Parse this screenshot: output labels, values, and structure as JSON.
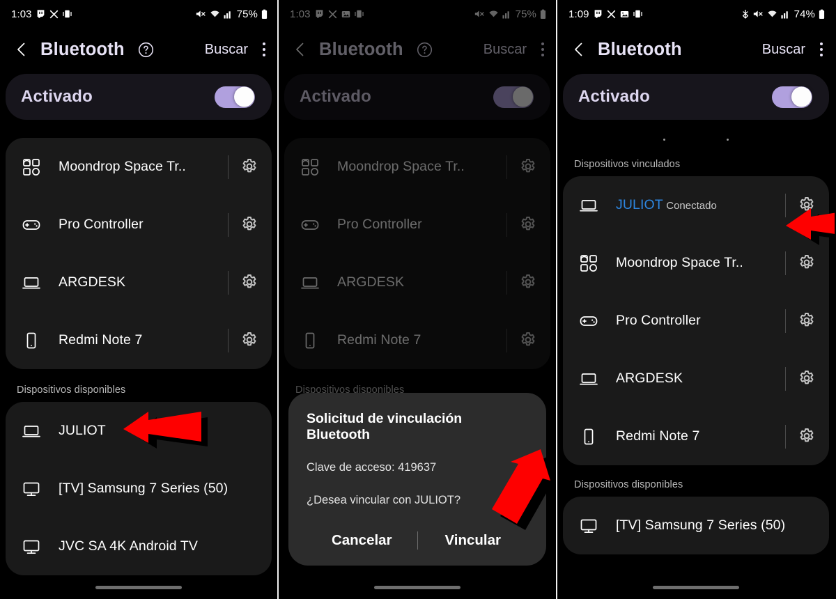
{
  "accent": {
    "toggle_track": "#b0a0de",
    "title_text": "#e8e3f6",
    "connected_blue": "#2d86e0",
    "arrow_red": "#fe0000",
    "card_bg": "#1a1a1a",
    "toggle_card_bg": "#17151c"
  },
  "panels": [
    {
      "id": "panel-available",
      "status_bar": {
        "time": "1:03",
        "battery_percent": "75%",
        "left_icons": [
          "twitch-icon",
          "x-icon",
          "vibrate-mode-icon"
        ],
        "right_icons": [
          "mute-icon",
          "wifi-icon",
          "cellular-signal-icon",
          "battery-icon"
        ]
      },
      "app_bar": {
        "back_label": "back-chevron-icon",
        "title": "Bluetooth",
        "help_label": "help-icon",
        "search_label": "Buscar",
        "more_label": "more-options-icon"
      },
      "toggle": {
        "label": "Activado",
        "state": "on"
      },
      "sections": [
        {
          "header": null,
          "devices": [
            {
              "name": "Moondrop Space Tr..",
              "sub": null,
              "icon": "earbuds-icon",
              "gear": true,
              "connected": false
            },
            {
              "name": "Pro Controller",
              "sub": null,
              "icon": "gamepad-icon",
              "gear": true,
              "connected": false
            },
            {
              "name": "ARGDESK",
              "sub": null,
              "icon": "laptop-icon",
              "gear": true,
              "connected": false
            },
            {
              "name": "Redmi Note 7",
              "sub": null,
              "icon": "phone-icon",
              "gear": true,
              "connected": false
            }
          ]
        },
        {
          "header": "Dispositivos disponibles",
          "devices": [
            {
              "name": "JULIOT",
              "sub": null,
              "icon": "laptop-icon",
              "gear": false,
              "connected": false
            },
            {
              "name": "[TV] Samsung 7 Series (50)",
              "sub": null,
              "icon": "tv-icon",
              "gear": false,
              "connected": false
            },
            {
              "name": "JVC SA 4K Android TV",
              "sub": null,
              "icon": "tv-icon",
              "gear": false,
              "connected": false
            }
          ]
        }
      ],
      "dimmed": false,
      "dialog": null
    },
    {
      "id": "panel-pair-request",
      "status_bar": {
        "time": "1:03",
        "battery_percent": "75%",
        "left_icons": [
          "twitch-icon",
          "x-icon",
          "photo-icon",
          "vibrate-mode-icon"
        ],
        "right_icons": [
          "mute-icon",
          "wifi-icon",
          "cellular-signal-icon",
          "battery-icon"
        ]
      },
      "app_bar": {
        "back_label": "back-chevron-icon",
        "title": "Bluetooth",
        "help_label": "help-icon",
        "search_label": "Buscar",
        "more_label": "more-options-icon"
      },
      "toggle": {
        "label": "Activado",
        "state": "on"
      },
      "sections": [
        {
          "header": null,
          "devices": [
            {
              "name": "Moondrop Space Tr..",
              "sub": null,
              "icon": "earbuds-icon",
              "gear": true,
              "connected": false
            },
            {
              "name": "Pro Controller",
              "sub": null,
              "icon": "gamepad-icon",
              "gear": true,
              "connected": false
            },
            {
              "name": "ARGDESK",
              "sub": null,
              "icon": "laptop-icon",
              "gear": true,
              "connected": false
            },
            {
              "name": "Redmi Note 7",
              "sub": null,
              "icon": "phone-icon",
              "gear": true,
              "connected": false
            }
          ]
        },
        {
          "header": "Dispositivos disponibles",
          "devices": []
        }
      ],
      "dimmed": true,
      "dialog": {
        "title": "Solicitud de vinculación Bluetooth",
        "passkey_line": "Clave de acceso: 419637",
        "question": "¿Desea vincular con JULIOT?",
        "cancel_label": "Cancelar",
        "confirm_label": "Vincular"
      }
    },
    {
      "id": "panel-paired",
      "status_bar": {
        "time": "1:09",
        "battery_percent": "74%",
        "left_icons": [
          "twitch-icon",
          "x-icon",
          "photo-icon",
          "vibrate-mode-icon"
        ],
        "right_icons": [
          "bluetooth-icon",
          "mute-icon",
          "wifi-icon",
          "cellular-signal-icon",
          "battery-icon"
        ]
      },
      "app_bar": {
        "back_label": "back-chevron-icon",
        "title": "Bluetooth",
        "help_label": null,
        "search_label": "Buscar",
        "more_label": "more-options-icon"
      },
      "toggle": {
        "label": "Activado",
        "state": "on"
      },
      "scanning": true,
      "sections": [
        {
          "header": "Dispositivos vinculados",
          "devices": [
            {
              "name": "JULIOT",
              "sub": "Conectado",
              "icon": "laptop-icon",
              "gear": true,
              "connected": true
            },
            {
              "name": "Moondrop Space Tr..",
              "sub": null,
              "icon": "earbuds-icon",
              "gear": true,
              "connected": false
            },
            {
              "name": "Pro Controller",
              "sub": null,
              "icon": "gamepad-icon",
              "gear": true,
              "connected": false
            },
            {
              "name": "ARGDESK",
              "sub": null,
              "icon": "laptop-icon",
              "gear": true,
              "connected": false
            },
            {
              "name": "Redmi Note 7",
              "sub": null,
              "icon": "phone-icon",
              "gear": true,
              "connected": false
            }
          ]
        },
        {
          "header": "Dispositivos disponibles",
          "devices": [
            {
              "name": "[TV] Samsung 7 Series (50)",
              "sub": null,
              "icon": "tv-icon",
              "gear": false,
              "connected": false
            }
          ]
        }
      ],
      "dimmed": false,
      "dialog": null
    }
  ],
  "annotations": [
    {
      "name": "arrow-to-juliot-available",
      "panel": 0,
      "points_to": "JULIOT"
    },
    {
      "name": "arrow-to-vincular-button",
      "panel": 1,
      "points_to": "Vincular"
    },
    {
      "name": "arrow-to-juliot-connected",
      "panel": 2,
      "points_to": "JULIOT"
    }
  ]
}
